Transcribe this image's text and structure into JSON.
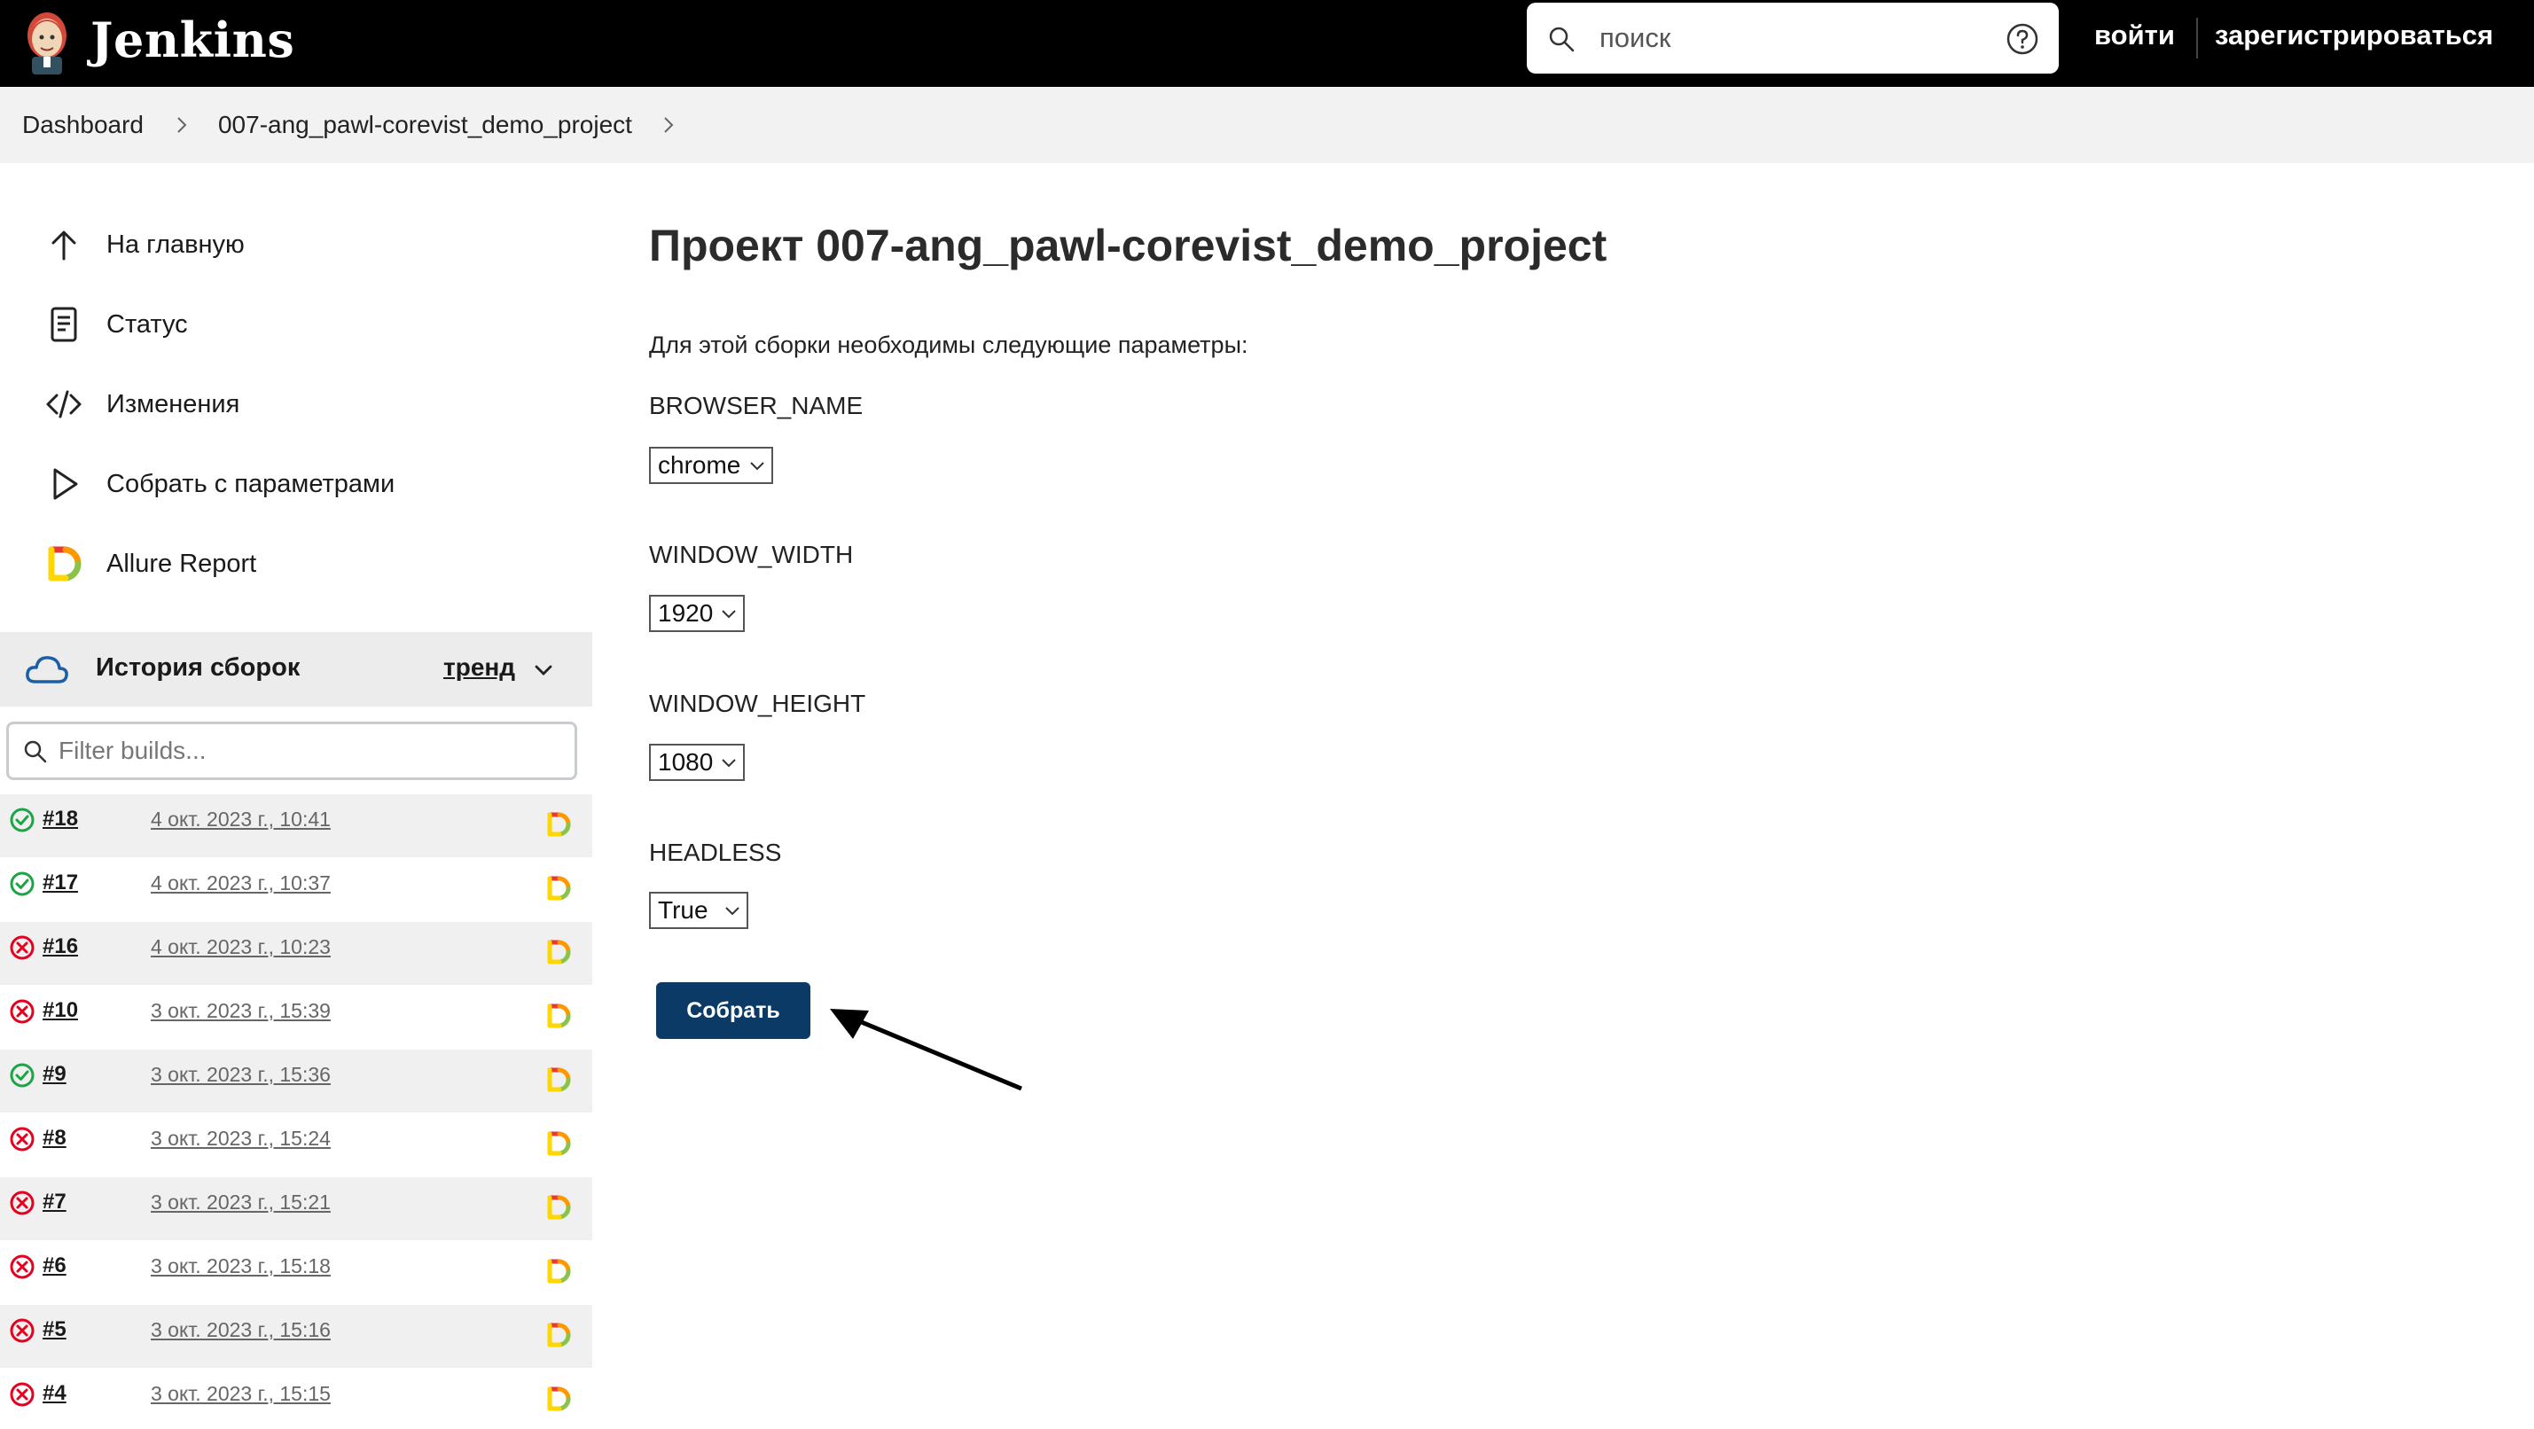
{
  "header": {
    "brand": "Jenkins",
    "search_placeholder": "поиск",
    "login": "войти",
    "register": "зарегистрироваться"
  },
  "breadcrumb": {
    "items": [
      "Dashboard",
      "007-ang_pawl-corevist_demo_project"
    ]
  },
  "sidebar": {
    "tasks": [
      {
        "label": "На главную",
        "icon": "arrow-up-icon"
      },
      {
        "label": "Статус",
        "icon": "document-icon"
      },
      {
        "label": "Изменения",
        "icon": "code-icon"
      },
      {
        "label": "Собрать с параметрами",
        "icon": "play-icon"
      },
      {
        "label": "Allure Report",
        "icon": "allure-icon"
      }
    ],
    "build_history": {
      "title": "История сборок",
      "trend": "тренд",
      "filter_placeholder": "Filter builds...",
      "builds": [
        {
          "number": "#18",
          "date": "4 окт. 2023 г., 10:41",
          "status": "success"
        },
        {
          "number": "#17",
          "date": "4 окт. 2023 г., 10:37",
          "status": "success"
        },
        {
          "number": "#16",
          "date": "4 окт. 2023 г., 10:23",
          "status": "failed"
        },
        {
          "number": "#10",
          "date": "3 окт. 2023 г., 15:39",
          "status": "failed"
        },
        {
          "number": "#9",
          "date": "3 окт. 2023 г., 15:36",
          "status": "success"
        },
        {
          "number": "#8",
          "date": "3 окт. 2023 г., 15:24",
          "status": "failed"
        },
        {
          "number": "#7",
          "date": "3 окт. 2023 г., 15:21",
          "status": "failed"
        },
        {
          "number": "#6",
          "date": "3 окт. 2023 г., 15:18",
          "status": "failed"
        },
        {
          "number": "#5",
          "date": "3 окт. 2023 г., 15:16",
          "status": "failed"
        },
        {
          "number": "#4",
          "date": "3 окт. 2023 г., 15:15",
          "status": "failed"
        }
      ]
    }
  },
  "main": {
    "title": "Проект 007-ang_pawl-corevist_demo_project",
    "description": "Для этой сборки необходимы следующие параметры:",
    "params": [
      {
        "name": "BROWSER_NAME",
        "value": "chrome"
      },
      {
        "name": "WINDOW_WIDTH",
        "value": "1920"
      },
      {
        "name": "WINDOW_HEIGHT",
        "value": "1080"
      },
      {
        "name": "HEADLESS",
        "value": "True"
      }
    ],
    "build_button": "Собрать"
  },
  "colors": {
    "header_bg": "#000000",
    "button_bg": "#0b3a66",
    "success": "#1ea446",
    "failed": "#e6001f"
  }
}
